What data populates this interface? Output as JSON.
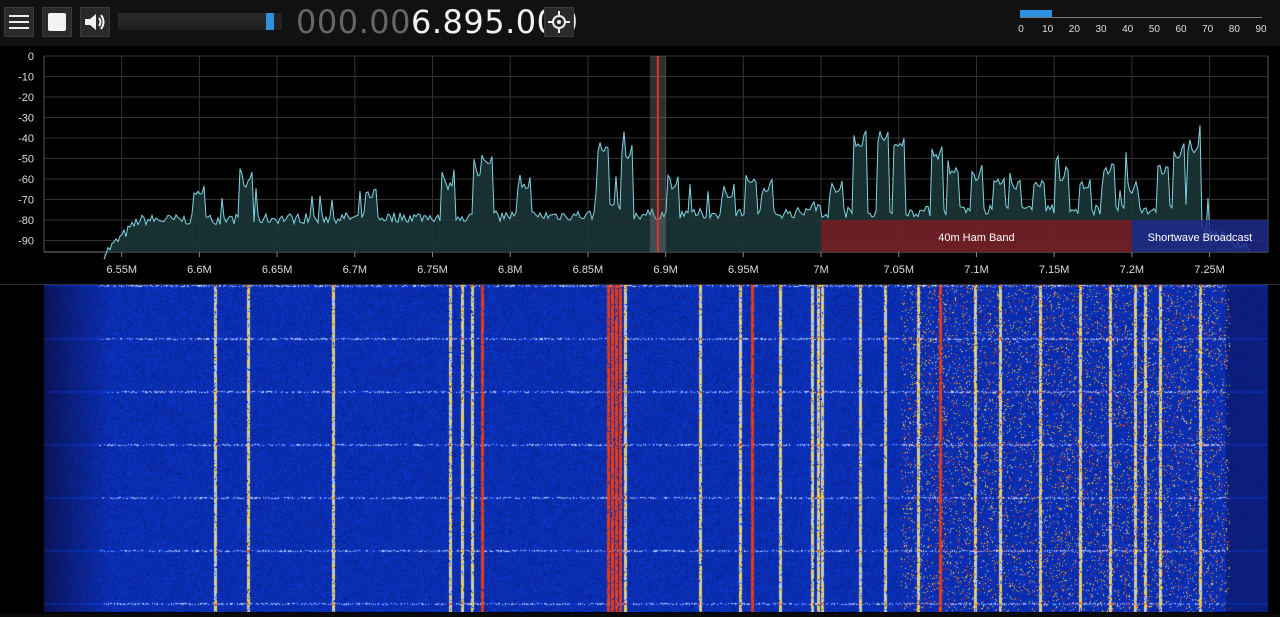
{
  "toolbar": {
    "menu_icon": "hamburger-menu-icon",
    "stop_icon": "stop-icon",
    "volume_icon": "speaker-volume-icon",
    "target_icon": "crosshair-target-icon",
    "volume_level": 0.95
  },
  "frequency": {
    "dim": "000.00",
    "bright": "6.895.000"
  },
  "snr_meter": {
    "level": 12,
    "ticks": [
      "0",
      "10",
      "20",
      "30",
      "40",
      "50",
      "60",
      "70",
      "80",
      "90"
    ]
  },
  "spectrum": {
    "y_labels": [
      "0",
      "-10",
      "-20",
      "-30",
      "-40",
      "-50",
      "-60",
      "-70",
      "-80",
      "-90"
    ],
    "x_labels": [
      "6.55M",
      "6.6M",
      "6.65M",
      "6.7M",
      "6.75M",
      "6.8M",
      "6.85M",
      "6.9M",
      "6.95M",
      "7M",
      "7.05M",
      "7.1M",
      "7.15M",
      "7.2M",
      "7.25M"
    ],
    "bands": [
      {
        "name": "40m Ham Band",
        "start": 7.0,
        "end": 7.2,
        "color": "#7a1c22"
      },
      {
        "name": "Shortwave Broadcast",
        "start": 7.2,
        "end": 7.3,
        "color": "#1f2a8c"
      }
    ],
    "tuned_mhz": 6.895,
    "colors": {
      "trace": "#7fd4e0",
      "fill": "#1c3538",
      "grid": "#333333"
    }
  }
}
